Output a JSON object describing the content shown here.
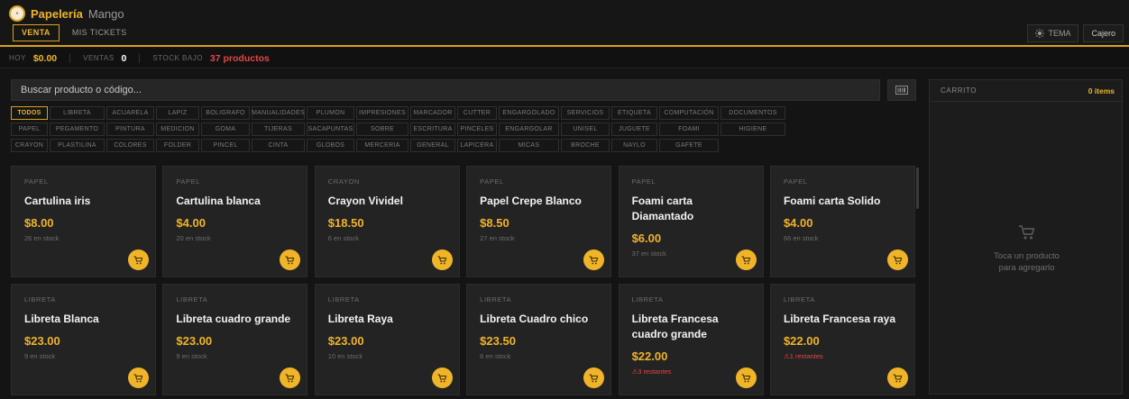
{
  "header": {
    "brand": "Papelería",
    "brand_sub": "Mango",
    "tabs": [
      {
        "label": "VENTA",
        "active": true
      },
      {
        "label": "MIS TICKETS",
        "active": false
      }
    ],
    "theme_label": "TEMA",
    "user_label": "Cajero"
  },
  "stats": {
    "today_label": "HOY",
    "today_value": "$0.00",
    "sales_label": "VENTAS",
    "sales_value": "0",
    "low_stock_label": "STOCK BAJO",
    "low_stock_value": "37 productos"
  },
  "search": {
    "placeholder": "Buscar producto o código..."
  },
  "categories": [
    [
      "TODOS",
      "LIBRETA",
      "ACUARELA",
      "LAPIZ",
      "BOLIGRAFO",
      "MANUALIDADES",
      "PLUMON",
      "IMPRESIONES",
      "MARCADOR",
      "CUTTER",
      "ENGARGOLADO",
      "SERVICIOS",
      "ETIQUETA",
      "COMPUTACIÓN",
      "DOCUMENTOS"
    ],
    [
      "PAPEL",
      "PEGAMENTO",
      "PINTURA",
      "MEDICION",
      "GOMA",
      "TIJERAS",
      "SACAPUNTAS",
      "SOBRE",
      "ESCRITURA",
      "PINCELES",
      "ENGARGOLAR",
      "UNISEL",
      "JUGUETE",
      "FOAMI",
      "HIGIENE"
    ],
    [
      "CRAYON",
      "PLASTILINA",
      "COLORES",
      "FOLDER",
      "PINCEL",
      "CINTA",
      "GLOBOS",
      "MERCERIA",
      "GENERAL",
      "LAPICERA",
      "MICAS",
      "BROCHE",
      "NAYLO",
      "GAFETE"
    ]
  ],
  "products": [
    {
      "category": "PAPEL",
      "name": "Cartulina iris",
      "price": "$8.00",
      "stock": "26 en stock",
      "low": false
    },
    {
      "category": "PAPEL",
      "name": "Cartulina blanca",
      "price": "$4.00",
      "stock": "20 en stock",
      "low": false
    },
    {
      "category": "CRAYON",
      "name": "Crayon Vividel",
      "price": "$18.50",
      "stock": "6 en stock",
      "low": false
    },
    {
      "category": "PAPEL",
      "name": "Papel Crepe Blanco",
      "price": "$8.50",
      "stock": "27 en stock",
      "low": false
    },
    {
      "category": "PAPEL",
      "name": "Foami carta Diamantado",
      "price": "$6.00",
      "stock": "37 en stock",
      "low": false
    },
    {
      "category": "PAPEL",
      "name": "Foami carta Solido",
      "price": "$4.00",
      "stock": "66 en stock",
      "low": false
    },
    {
      "category": "LIBRETA",
      "name": "Libreta Blanca",
      "price": "$23.00",
      "stock": "9 en stock",
      "low": false
    },
    {
      "category": "LIBRETA",
      "name": "Libreta cuadro grande",
      "price": "$23.00",
      "stock": "9 en stock",
      "low": false
    },
    {
      "category": "LIBRETA",
      "name": "Libreta Raya",
      "price": "$23.00",
      "stock": "10 en stock",
      "low": false
    },
    {
      "category": "LIBRETA",
      "name": "Libreta Cuadro chico",
      "price": "$23.50",
      "stock": "6 en stock",
      "low": false
    },
    {
      "category": "LIBRETA",
      "name": "Libreta Francesa cuadro grande",
      "price": "$22.00",
      "stock": "3 restantes",
      "low": true
    },
    {
      "category": "LIBRETA",
      "name": "Libreta Francesa raya",
      "price": "$22.00",
      "stock": "1 restantes",
      "low": true
    }
  ],
  "cart": {
    "title": "CARRITO",
    "count": "0 items",
    "empty_line1": "Toca un producto",
    "empty_line2": "para agregarlo"
  },
  "colors": {
    "accent": "#f0b429",
    "danger": "#e64545",
    "background": "#141414",
    "card": "#232323"
  }
}
